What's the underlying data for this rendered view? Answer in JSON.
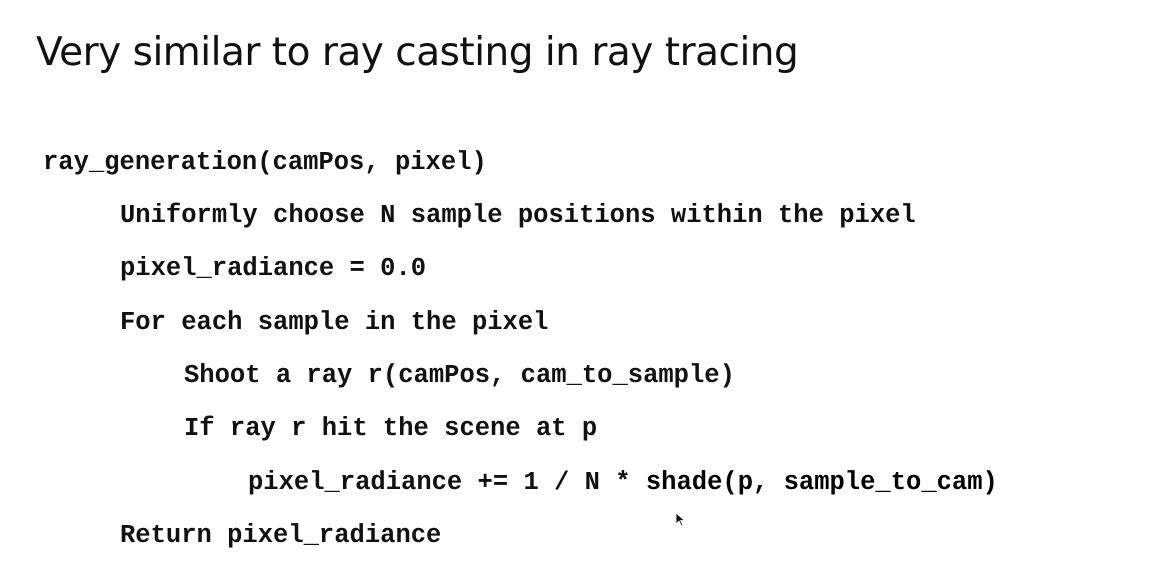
{
  "slide": {
    "title": "Very similar to ray casting in ray tracing",
    "code": [
      {
        "text": "ray_generation(camPos, pixel)"
      },
      {
        "text": "Uniformly choose N sample positions within the pixel"
      },
      {
        "text": "pixel_radiance = 0.0"
      },
      {
        "text": "For each sample in the pixel"
      },
      {
        "text": "Shoot a ray r(camPos, cam_to_sample)"
      },
      {
        "text": "If ray r hit the scene at p"
      },
      {
        "text": "pixel_radiance += 1 / N * ",
        "bold": "shade(p, sample_to_cam)"
      },
      {
        "text": "Return pixel_radiance"
      }
    ]
  }
}
